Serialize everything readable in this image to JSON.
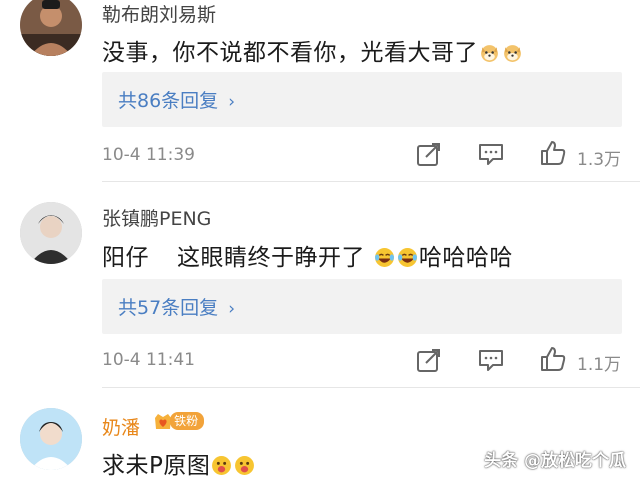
{
  "comments": [
    {
      "username": "勒布朗刘易斯",
      "text": "没事，你不说都不看你，光看大哥了",
      "emojis": [
        "doge-emoji",
        "doge-emoji"
      ],
      "reply_label": "共86条回复",
      "time": "10-4 11:39",
      "like_count": "1.3万"
    },
    {
      "username": "张镇鹏PENG",
      "text_part1": "阳仔",
      "text_part2": "这眼睛终于睁开了",
      "text_part3": "哈哈哈哈",
      "emojis": [
        "laugh-cry-emoji",
        "laugh-cry-emoji"
      ],
      "reply_label": "共57条回复",
      "time": "10-4 11:41",
      "like_count": "1.1万"
    },
    {
      "username": "奶潘",
      "badge": "铁粉",
      "text": "求未P原图",
      "emojis": [
        "tongue-emoji",
        "tongue-emoji"
      ]
    }
  ],
  "watermark": "头条 @放松吃个瓜",
  "icons": {
    "share": "share-icon",
    "comment": "comment-icon",
    "like": "thumbs-up-icon",
    "reply_chevron": "chevron-right-icon"
  },
  "colors": {
    "link": "#4a7ec2",
    "username": "#444444",
    "fan_username": "#e8871a",
    "badge": "#f2a33a",
    "reply_bg": "#f2f2f2",
    "meta": "#8a8a8a"
  }
}
